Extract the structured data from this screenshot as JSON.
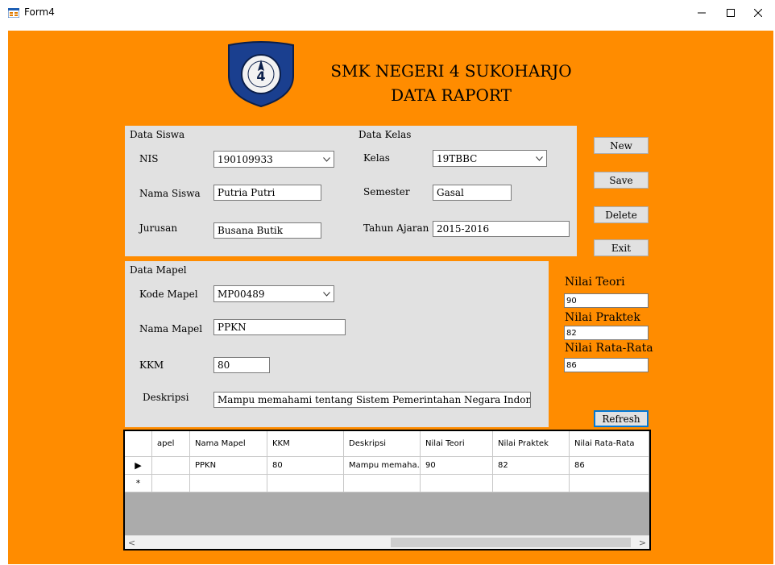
{
  "window": {
    "title": "Form4"
  },
  "header": {
    "line1": "SMK NEGERI 4 SUKOHARJO",
    "line2": "DATA RAPORT"
  },
  "data_siswa": {
    "title": "Data Siswa",
    "nis_label": "NIS",
    "nis_value": "190109933",
    "nama_label": "Nama Siswa",
    "nama_value": "Putria Putri",
    "jurusan_label": "Jurusan",
    "jurusan_value": "Busana Butik"
  },
  "data_kelas": {
    "title": "Data Kelas",
    "kelas_label": "Kelas",
    "kelas_value": "19TBBC",
    "semester_label": "Semester",
    "semester_value": "Gasal",
    "tahun_label": "Tahun Ajaran",
    "tahun_value": "2015-2016"
  },
  "buttons": {
    "new": "New",
    "save": "Save",
    "delete": "Delete",
    "exit": "Exit",
    "refresh": "Refresh"
  },
  "data_mapel": {
    "title": "Data Mapel",
    "kode_label": "Kode Mapel",
    "kode_value": "MP00489",
    "nama_label": "Nama Mapel",
    "nama_value": "PPKN",
    "kkm_label": "KKM",
    "kkm_value": "80",
    "deskripsi_label": "Deskripsi",
    "deskripsi_value": "Mampu memahami tentang Sistem Pemerintahan Negara Indonesia"
  },
  "nilai": {
    "teori_label": "Nilai Teori",
    "teori_value": "90",
    "praktek_label": "Nilai Praktek",
    "praktek_value": "82",
    "rata_label": "Nilai Rata-Rata",
    "rata_value": "86"
  },
  "grid": {
    "columns": [
      "apel",
      "Nama Mapel",
      "KKM",
      "Deskripsi",
      "Nilai Teori",
      "Nilai Praktek",
      "Nilai Rata-Rata"
    ],
    "rows": [
      {
        "marker": "▶",
        "cells": [
          "",
          "PPKN",
          "80",
          "Mampu memaha...",
          "90",
          "82",
          "86"
        ]
      },
      {
        "marker": "*",
        "cells": [
          "",
          "",
          "",
          "",
          "",
          "",
          ""
        ]
      }
    ]
  },
  "colors": {
    "form_bg": "#ff8c00",
    "group_bg": "#e1e1e1",
    "focus_border": "#0078d7"
  }
}
